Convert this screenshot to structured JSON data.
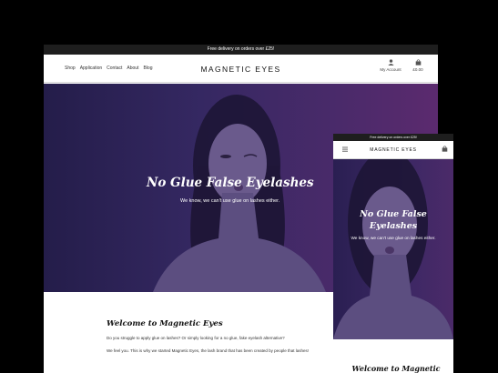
{
  "desktop": {
    "announcement": "Free delivery on orders over £25!",
    "nav": [
      "Shop",
      "Application",
      "Contact",
      "About",
      "Blog"
    ],
    "logo": "MAGNETIC EYES",
    "account_label": "My Account",
    "cart_total": "£0.00",
    "hero": {
      "title": "No Glue False Eyelashes",
      "subtitle": "We know, we can't use glue on lashes either."
    },
    "welcome": {
      "title": "Welcome to Magnetic Eyes",
      "paragraph1": "Do you struggle to apply glue on lashes? Or simply looking for a no glue, fake eyelash alternative?",
      "paragraph2": "We feel you. This is why we started Magnetic Eyes, the lash brand that has been created by people that lashes!"
    }
  },
  "mobile": {
    "announcement": "Free delivery on orders over £25!",
    "logo": "MAGNETIC EYES",
    "hero": {
      "title": "No Glue False Eyelashes",
      "subtitle": "We know, we can't use glue on lashes either."
    },
    "welcome_title": "Welcome to Magnetic"
  },
  "icons": {
    "account": "user-icon",
    "cart": "shopping-bag-icon",
    "menu": "hamburger-icon"
  },
  "colors": {
    "topbar": "#1e1e1e",
    "hero_left": "#241d4a",
    "hero_right": "#5b2a6e"
  }
}
